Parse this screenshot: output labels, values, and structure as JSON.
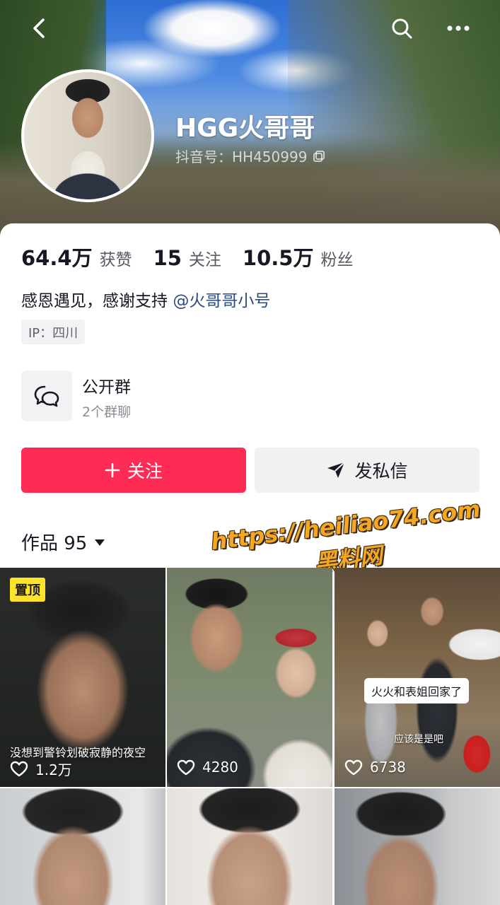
{
  "header": {
    "nickname": "HGG火哥哥",
    "douyin_id": "抖音号：HH450999"
  },
  "stats": [
    {
      "value": "64.4万",
      "label": "获赞"
    },
    {
      "value": "15",
      "label": "关注"
    },
    {
      "value": "10.5万",
      "label": "粉丝"
    }
  ],
  "bio": {
    "text": "感恩遇见，感谢支持",
    "mention": "@火哥哥小号"
  },
  "ip": "IP：四川",
  "group": {
    "title": "公开群",
    "subtitle": "2个群聊"
  },
  "actions": {
    "follow_label": "关注",
    "message_label": "发私信"
  },
  "works": {
    "label": "作品 95"
  },
  "watermark": {
    "line1": "https://heiliao74.com",
    "line2": "黑料网"
  },
  "videos": [
    {
      "pinned_label": "置顶",
      "caption": "没想到警铃划破寂静的夜空",
      "likes": "1.2万"
    },
    {
      "likes": "4280"
    },
    {
      "bubble": "火火和表姐回家了",
      "subtitle": "应该是是吧",
      "likes": "6738"
    },
    {},
    {},
    {}
  ],
  "colors": {
    "accent": "#fe2c55",
    "mention": "#2c4a88",
    "pin": "#fde42b"
  }
}
